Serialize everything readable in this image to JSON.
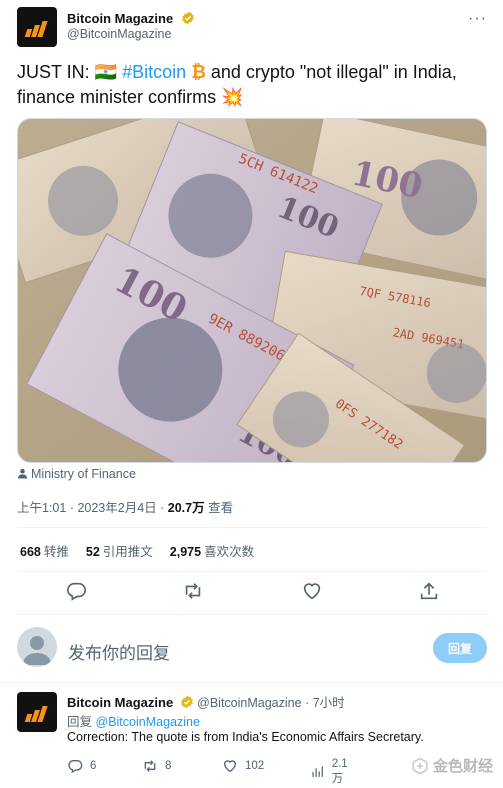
{
  "author": {
    "name": "Bitcoin Magazine",
    "handle": "@BitcoinMagazine"
  },
  "tweet": {
    "text_part1": "JUST IN: ",
    "flag": "🇮🇳",
    "hashtag": "#Bitcoin",
    "btc_symbol": "₿",
    "text_part2": " and crypto \"not illegal\" in India, finance minister confirms ",
    "emoji": "💥",
    "media_source": "Ministry of Finance",
    "time": "上午1:01",
    "date": "2023年2月4日",
    "views_count": "20.7万",
    "views_label": "查看"
  },
  "stats": {
    "retweets_count": "668",
    "retweets_label": "转推",
    "quotes_count": "52",
    "quotes_label": "引用推文",
    "likes_count": "2,975",
    "likes_label": "喜欢次数"
  },
  "reply_box": {
    "placeholder": "发布你的回复",
    "button_label": "回复"
  },
  "reply": {
    "name": "Bitcoin Magazine",
    "handle": "@BitcoinMagazine",
    "age": "7小时",
    "replying_to_label": "回复",
    "replying_to_handle": "@BitcoinMagazine",
    "body": "Correction: The quote is from India's Economic Affairs Secretary.",
    "replies": "6",
    "retweets": "8",
    "likes": "102",
    "views": "2.1万"
  },
  "watermark": {
    "text": "金色财经"
  },
  "colors": {
    "accent": "#1d9bf0",
    "bitcoin_orange": "#f7931a",
    "reply_button": "#8ecdf8",
    "secondary_text": "#536471"
  }
}
